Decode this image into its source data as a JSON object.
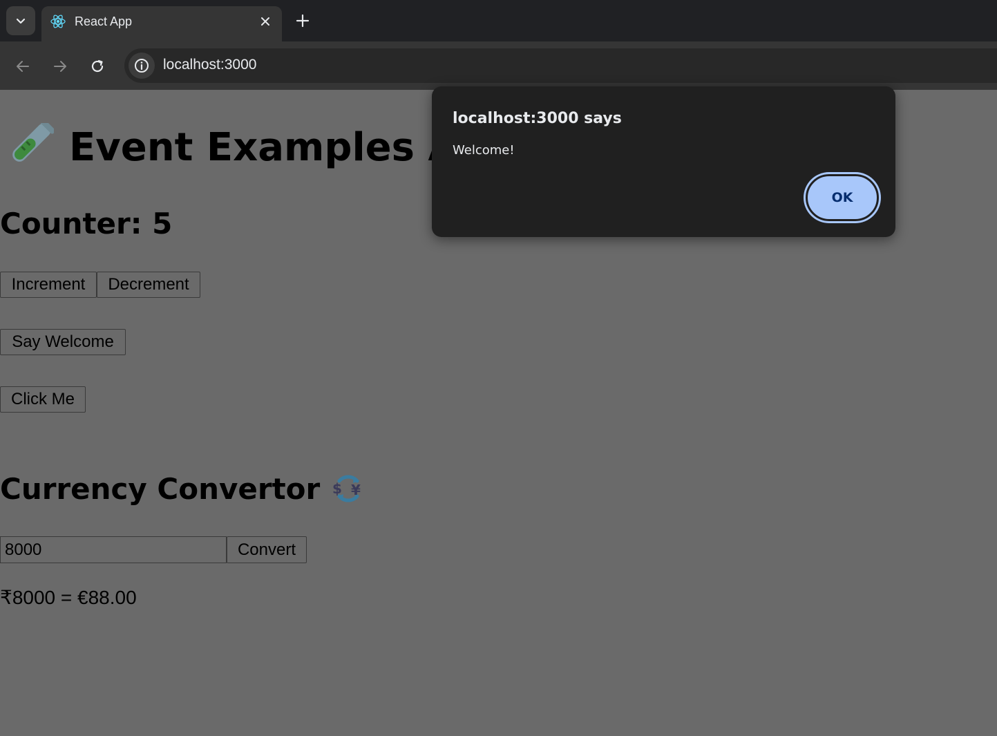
{
  "browser": {
    "tab": {
      "title": "React App",
      "favicon": "react-logo-icon"
    },
    "address_bar": {
      "url": "localhost:3000"
    },
    "colors": {
      "chrome_dark": "#202124",
      "toolbar": "#353535"
    }
  },
  "page": {
    "title": "Event Examples App",
    "title_emoji": "test-tube-icon",
    "counter_heading": "Counter: 5",
    "buttons": {
      "increment": "Increment",
      "decrement": "Decrement",
      "say_welcome": "Say Welcome",
      "click_me": "Click Me",
      "convert": "Convert"
    },
    "currency_heading": "Currency Convertor",
    "currency_emoji": "currency-exchange-icon",
    "amount_value": "8000",
    "result": "₹8000 = €88.00"
  },
  "dialog": {
    "title": "localhost:3000 says",
    "message": "Welcome!",
    "ok_label": "OK",
    "accent": "#a8c7fa"
  }
}
